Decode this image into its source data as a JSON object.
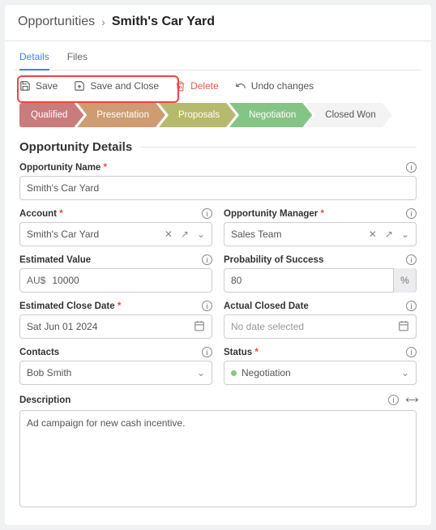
{
  "breadcrumb": {
    "root": "Opportunities",
    "current": "Smith's Car Yard"
  },
  "tabs": {
    "details": "Details",
    "files": "Files"
  },
  "toolbar": {
    "save": "Save",
    "save_close": "Save and Close",
    "delete": "Delete",
    "undo": "Undo changes"
  },
  "stages": {
    "items": [
      {
        "label": "Qualified",
        "color": "#c97c7c"
      },
      {
        "label": "Presentation",
        "color": "#ce9c70"
      },
      {
        "label": "Proposals",
        "color": "#b6ba6e"
      },
      {
        "label": "Negotiation",
        "color": "#84c487"
      },
      {
        "label": "Closed Won",
        "color": "#f3f3f3"
      }
    ]
  },
  "section": {
    "title": "Opportunity Details"
  },
  "fields": {
    "opportunity_name": {
      "label": "Opportunity Name",
      "value": "Smith's Car Yard"
    },
    "account": {
      "label": "Account",
      "value": "Smith's Car Yard"
    },
    "opportunity_manager": {
      "label": "Opportunity Manager",
      "value": "Sales Team"
    },
    "estimated_value": {
      "label": "Estimated Value",
      "prefix": "AU$",
      "value": "10000"
    },
    "probability": {
      "label": "Probability of Success",
      "value": "80",
      "suffix": "%"
    },
    "estimated_close": {
      "label": "Estimated Close Date",
      "value": "Sat Jun 01 2024"
    },
    "actual_close": {
      "label": "Actual Closed Date",
      "value": "No date selected"
    },
    "contacts": {
      "label": "Contacts",
      "value": "Bob  Smith"
    },
    "status": {
      "label": "Status",
      "value": "Negotiation",
      "dot_color": "#84c487"
    },
    "description": {
      "label": "Description",
      "value": "Ad campaign for new cash incentive."
    }
  }
}
